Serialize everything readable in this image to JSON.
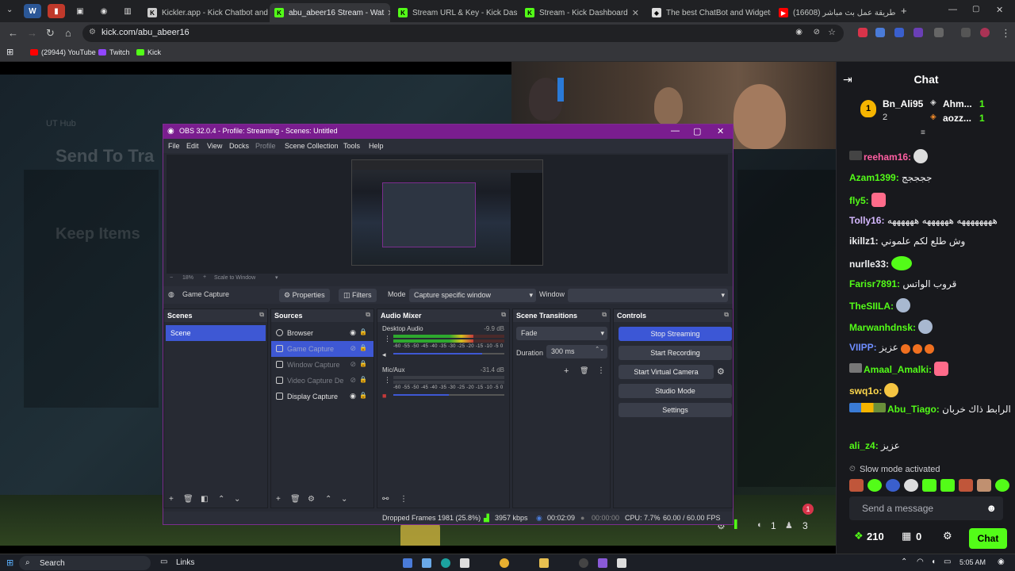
{
  "browser": {
    "tabs": [
      {
        "title": "Kickler.app - Kick Chatbot and"
      },
      {
        "title": "abu_abeer16 Stream - Wat"
      },
      {
        "title": "Stream URL & Key - Kick Dash"
      },
      {
        "title": "Stream - Kick Dashboard"
      },
      {
        "title": "The best ChatBot and Widgets"
      },
      {
        "title": "(16608) طريقة عمل بث مباشر"
      }
    ],
    "url": "kick.com/abu_abeer16",
    "bookmarks": [
      {
        "label": "(29944) YouTube"
      },
      {
        "label": "Twitch"
      },
      {
        "label": "Kick"
      }
    ]
  },
  "stream_bg": {
    "text1": "UT Hub",
    "text2": "Send To Tra",
    "text3": "Keep Items"
  },
  "obs": {
    "title": "OBS 32.0.4 - Profile: Streaming - Scenes: Untitled",
    "menu": [
      "File",
      "Edit",
      "View",
      "Docks",
      "Profile",
      "Scene Collection",
      "Tools",
      "Help"
    ],
    "zoom": "18%",
    "scale_mode": "Scale to Window",
    "source_toolbar": {
      "source_name": "Game Capture",
      "properties": "Properties",
      "filters": "Filters",
      "mode_label": "Mode",
      "mode_value": "Capture specific window",
      "window_label": "Window",
      "window_value": ""
    },
    "scenes": {
      "title": "Scenes",
      "items": [
        "Scene"
      ]
    },
    "sources": {
      "title": "Sources",
      "items": [
        "Browser",
        "Game Capture",
        "Window Capture",
        "Video Capture De",
        "Display Capture"
      ]
    },
    "audio": {
      "title": "Audio Mixer",
      "tracks": [
        {
          "name": "Desktop Audio",
          "db": "-9.9 dB",
          "level": 0.72,
          "volume": 0.8
        },
        {
          "name": "Mic/Aux",
          "db": "-31.4 dB",
          "level": 0.0,
          "volume": 0.5
        }
      ],
      "scale": "-60 -55 -50 -45 -40 -35 -30 -25 -20 -15 -10 -5 0"
    },
    "transitions": {
      "title": "Scene Transitions",
      "type": "Fade",
      "duration_label": "Duration",
      "duration_value": "300 ms"
    },
    "controls": {
      "title": "Controls",
      "buttons": [
        "Stop Streaming",
        "Start Recording",
        "Start Virtual Camera",
        "Studio Mode",
        "Settings"
      ]
    },
    "status": {
      "dropped": "Dropped Frames 1981 (25.8%)",
      "bitrate": "3957 kbps",
      "stream_time": "00:02:09",
      "rec_time": "00:00:00",
      "cpu": "CPU: 7.7%",
      "fps": "60.00 / 60.00 FPS"
    }
  },
  "chat": {
    "title": "Chat",
    "leaders": [
      {
        "name": "Bn_Ali95",
        "count": "1",
        "sub": "2"
      },
      {
        "name": "Ahm...",
        "count": "1"
      },
      {
        "name": "aozz...",
        "count": "1"
      }
    ],
    "messages": [
      {
        "user": "reeham16:",
        "text": "",
        "color": "#ff5fa2"
      },
      {
        "user": "Azam1399:",
        "text": "ججججج",
        "color": "#53fc18"
      },
      {
        "user": "fly5:",
        "text": "",
        "color": "#53fc18"
      },
      {
        "user": "Tolly16:",
        "text": "ههههههههه ههههههه ههههههه",
        "color": "#d5b8ff"
      },
      {
        "user": "ikillz1:",
        "text": "وش طلع لكم علموني",
        "color": "#efeff1"
      },
      {
        "user": "nurlle33:",
        "text": "",
        "color": "#efeff1"
      },
      {
        "user": "Farisr7891:",
        "text": "قروب الواتس",
        "color": "#53fc18"
      },
      {
        "user": "TheSIILA:",
        "text": "",
        "color": "#53fc18"
      },
      {
        "user": "Marwanhdnsk:",
        "text": "",
        "color": "#53fc18"
      },
      {
        "user": "VIIPP:",
        "text": "عزيز",
        "color": "#6e8dff"
      },
      {
        "user": "Amaal_Amalki:",
        "text": "",
        "color": "#53fc18"
      },
      {
        "user": "swq1o:",
        "text": "",
        "color": "#ffd84d"
      },
      {
        "user": "Abu_Tiago:",
        "text": "الرابط ذاك خربان",
        "color": "#53fc18"
      },
      {
        "user": "ali_z4:",
        "text": "عزيز",
        "color": "#53fc18"
      }
    ],
    "slow_mode": "Slow mode activated",
    "input_placeholder": "Send a message",
    "points": "210",
    "gifts": "0",
    "send_label": "Chat",
    "notif_count": "1",
    "viewer_count": "1",
    "follow_count": "3"
  },
  "taskbar": {
    "search": "Search",
    "links": "Links",
    "time": "5:05 AM"
  }
}
